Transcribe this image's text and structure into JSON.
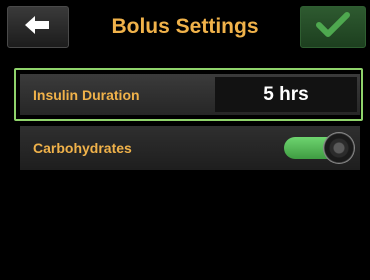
{
  "header": {
    "title": "Bolus Settings",
    "back_icon": "arrow-left-icon",
    "confirm_icon": "checkmark-icon"
  },
  "settings": [
    {
      "label": "Insulin Duration",
      "value": "5 hrs",
      "selected": true
    },
    {
      "label": "Carbohydrates",
      "toggle_on": true
    }
  ],
  "colors": {
    "label_accent": "#f0b24a",
    "selection_border": "#8fd36b",
    "toggle_on": "#5cc05e",
    "confirm_button": "#2a5a2c"
  }
}
